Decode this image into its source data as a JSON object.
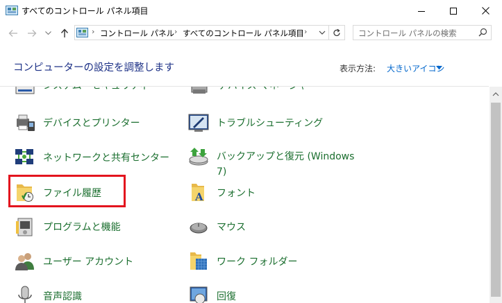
{
  "window": {
    "title": "すべてのコントロール パネル項目"
  },
  "address": {
    "crumbs": [
      "コントロール パネル",
      "すべてのコントロール パネル項目"
    ]
  },
  "search": {
    "placeholder": "コントロール パネルの検索"
  },
  "header": {
    "title": "コンピューターの設定を調整します",
    "view_by_label": "表示方法:",
    "view_by_value": "大きいアイコン"
  },
  "items": {
    "top_left_partial": "システム・セキュリティ",
    "top_right_partial": "デバイス マネージャー",
    "devices_printers": "デバイスとプリンター",
    "troubleshooting": "トラブルシューティング",
    "network_center": "ネットワークと共有センター",
    "backup_line1": "バックアップと復元 (Windows",
    "backup_line2": "7)",
    "file_history": "ファイル履歴",
    "fonts": "フォント",
    "programs": "プログラムと機能",
    "mouse": "マウス",
    "user_accounts": "ユーザー アカウント",
    "work_folders": "ワーク フォルダー",
    "speech": "音声認識",
    "recovery": "回復"
  },
  "colors": {
    "link_green": "#1a6e2e",
    "heading_blue": "#1e3287",
    "highlight_red": "#e3141e"
  }
}
